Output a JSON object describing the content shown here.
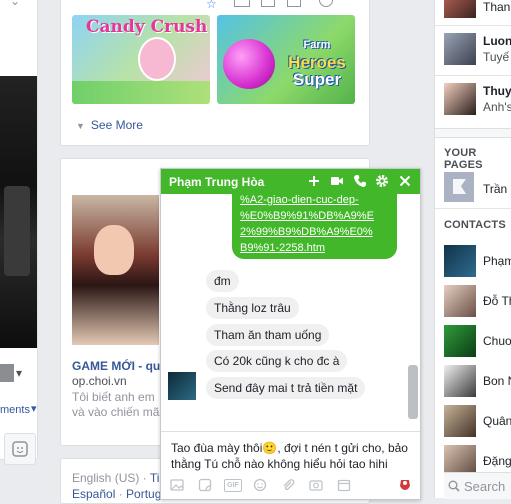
{
  "left_column": {
    "comments_label": "ments",
    "caret": "▾"
  },
  "games_card": {
    "candy_logo": "Candy Crush",
    "heroes_logo_line1": "Farm",
    "heroes_logo_line2": "Heroes",
    "heroes_logo_line3": "Super",
    "see_more": "See More"
  },
  "game_card": {
    "title": "GAME MỚI - qu",
    "domain": "op.choi.vn",
    "desc_line1": "Tôi biết anh em",
    "desc_line2": "và vào chiến mã"
  },
  "footer": {
    "lang_current": "English (US)",
    "lang_sep": " · ",
    "lang_next": "Ti",
    "lang_line2_a": "Español",
    "lang_line2_b": "Portug"
  },
  "sidebar": {
    "top_items": [
      {
        "name": "Than",
        "sub": ""
      },
      {
        "name": "Luon",
        "sub": "Tuyế"
      },
      {
        "name": "Thuy",
        "sub": "Anh's"
      }
    ],
    "your_pages_header": "YOUR PAGES",
    "page_item": "Trần",
    "contacts_header": "CONTACTS",
    "contacts": [
      "Phạm",
      "Đỗ Th",
      "Chuo",
      "Bon N",
      "Quân",
      "Đặng"
    ],
    "search_label": "Search"
  },
  "chat": {
    "title": "Phạm Trung Hòa",
    "link_lines": [
      "%A2-giao-dien-cuc-dep-",
      "%E0%B9%91%DB%A9%E",
      "2%99%B9%DB%A9%E0%",
      "B9%91-2258.htm"
    ],
    "incoming": [
      "đm",
      "Thằng loz trâu",
      "Tham ăn tham uống",
      "Có 20k cũng k cho đc à",
      "Send đây mai t trả tiền mặt"
    ],
    "composer_text": " Tao đùa mày thôi🙂, đợi t nén t gửi cho, bảo thằng Tú chỗ nào không hiểu hỏi tao hihi",
    "gif_label": "GIF"
  },
  "colors": {
    "facebook_green": "#42b72a",
    "link_blue": "#365899",
    "background": "#e9ebee"
  }
}
